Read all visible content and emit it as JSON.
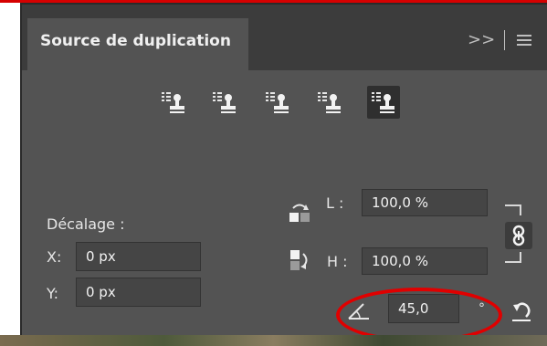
{
  "panel": {
    "tab_title": "Source de duplication",
    "collapse_label": ">>"
  },
  "sources": {
    "count": 5,
    "active_index": 4
  },
  "offset": {
    "title": "Décalage :",
    "x_label": "X:",
    "x_value": "0 px",
    "y_label": "Y:",
    "y_value": "0 px"
  },
  "scale": {
    "w_label": "L :",
    "w_value": "100,0 %",
    "h_label": "H :",
    "h_value": "100,0 %"
  },
  "rotation": {
    "value": "45,0",
    "unit": "°"
  },
  "colors": {
    "panel_bg": "#535353",
    "field_bg": "#454545",
    "highlight": "#e00000"
  },
  "icons": [
    "clone-source-icon",
    "flip-horizontal-icon",
    "flip-vertical-icon",
    "link-icon",
    "angle-icon",
    "reset-icon",
    "panel-menu-icon"
  ]
}
